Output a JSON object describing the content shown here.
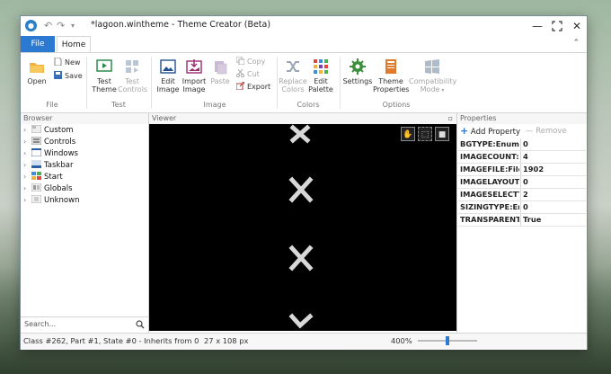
{
  "window": {
    "title": "*lagoon.wintheme - Theme Creator (Beta)",
    "buttons": [
      "minimize",
      "maximize",
      "close"
    ]
  },
  "quick_access": [
    "undo-icon",
    "redo-icon",
    "customize-icon"
  ],
  "tabs": {
    "file": "File",
    "home": "Home"
  },
  "ribbon": {
    "file_group": {
      "label": "File",
      "open": "Open",
      "new": "New",
      "save": "Save"
    },
    "test_group": {
      "label": "Test",
      "test_theme": [
        "Test",
        "Theme"
      ],
      "test_controls": [
        "Test",
        "Controls"
      ]
    },
    "image_group": {
      "label": "Image",
      "edit_image": [
        "Edit",
        "Image"
      ],
      "import_image": [
        "Import",
        "Image"
      ],
      "paste": "Paste",
      "copy": "Copy",
      "cut": "Cut",
      "export": "Export"
    },
    "colors_group": {
      "label": "Colors",
      "replace_colors": [
        "Replace",
        "Colors"
      ],
      "edit_palette": [
        "Edit",
        "Palette"
      ]
    },
    "options_group": {
      "label": "Options",
      "settings": "Settings",
      "theme_properties": [
        "Theme",
        "Properties"
      ],
      "compatibility_mode": [
        "Compatibility",
        "Mode"
      ]
    }
  },
  "browser": {
    "header": "Browser",
    "items": [
      {
        "label": "Custom",
        "icon": "custom-icon"
      },
      {
        "label": "Controls",
        "icon": "controls-icon"
      },
      {
        "label": "Windows",
        "icon": "windows-icon"
      },
      {
        "label": "Taskbar",
        "icon": "taskbar-icon"
      },
      {
        "label": "Start",
        "icon": "start-icon"
      },
      {
        "label": "Globals",
        "icon": "globals-icon"
      },
      {
        "label": "Unknown",
        "icon": "unknown-icon"
      }
    ],
    "search_placeholder": "Search..."
  },
  "viewer": {
    "header": "Viewer",
    "tools": [
      "hand-icon",
      "select-icon",
      "square-icon"
    ]
  },
  "properties": {
    "header": "Properties",
    "add_property": "Add Property",
    "remove": "Remove",
    "rows": [
      {
        "key": "BGTYPE:Enum",
        "value": "0"
      },
      {
        "key": "IMAGECOUNT:Int",
        "value": "4"
      },
      {
        "key": "IMAGEFILE:Filena",
        "value": "1902"
      },
      {
        "key": "IMAGELAYOUT:E",
        "value": "0"
      },
      {
        "key": "IMAGESELECTTYI",
        "value": "2"
      },
      {
        "key": "SIZINGTYPE:Enur",
        "value": "0"
      },
      {
        "key": "TRANSPARENT:B",
        "value": "True"
      }
    ]
  },
  "status": {
    "info": "Class #262, Part #1, State #0 - Inherits from 0",
    "size": "27 x 108 px",
    "zoom": "400%",
    "zoom_fraction": 0.5
  },
  "colors": {
    "accent": "#2b79d0",
    "viewer_bg": "#000000"
  }
}
